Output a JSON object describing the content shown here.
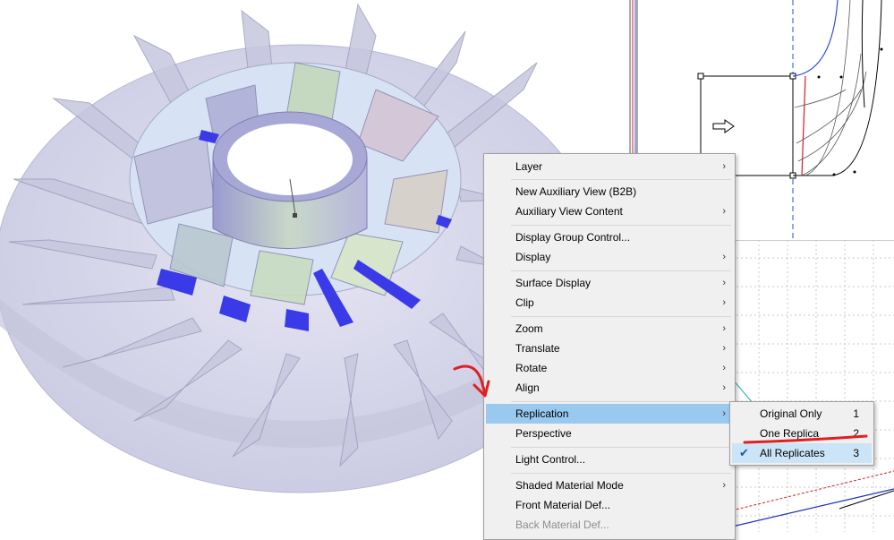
{
  "context_menu": {
    "items": [
      {
        "label": "Layer",
        "submenu": true
      },
      {
        "label": "New Auxiliary View (B2B)",
        "submenu": false
      },
      {
        "label": "Auxiliary View Content",
        "submenu": true
      },
      {
        "label": "Display Group Control...",
        "submenu": false
      },
      {
        "label": "Display",
        "submenu": true
      },
      {
        "label": "Surface Display",
        "submenu": true
      },
      {
        "label": "Clip",
        "submenu": true
      },
      {
        "label": "Zoom",
        "submenu": true
      },
      {
        "label": "Translate",
        "submenu": true
      },
      {
        "label": "Rotate",
        "submenu": true
      },
      {
        "label": "Align",
        "submenu": true
      },
      {
        "label": "Replication",
        "submenu": true,
        "highlighted": true
      },
      {
        "label": "Perspective",
        "submenu": false
      },
      {
        "label": "Light Control...",
        "submenu": false
      },
      {
        "label": "Shaded Material Mode",
        "submenu": true
      },
      {
        "label": "Front Material Def...",
        "submenu": false
      },
      {
        "label": "Back Material Def...",
        "submenu": false,
        "disabled": true
      }
    ]
  },
  "replication_submenu": {
    "items": [
      {
        "label": "Original Only",
        "key": "1",
        "checked": false
      },
      {
        "label": "One Replica",
        "key": "2",
        "checked": false
      },
      {
        "label": "All Replicates",
        "key": "3",
        "checked": true
      }
    ]
  },
  "icons": {
    "submenu_arrow": "›",
    "check": "✔"
  },
  "colors": {
    "menu_highlight": "#99c9ef",
    "annotation_red": "#e02020",
    "blade_blue": "#3a3ae8",
    "disc": "#d7d7ec"
  }
}
